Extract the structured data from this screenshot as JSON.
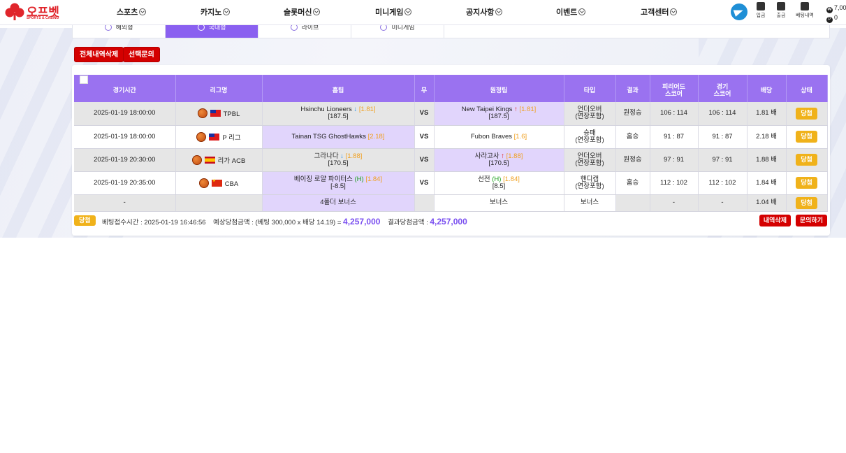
{
  "brand": {
    "name": "오프벳",
    "sub": "SPORTS & CASINO"
  },
  "nav": [
    "스포츠",
    "카지노",
    "슬롯머신",
    "미니게임",
    "공지사항",
    "이벤트",
    "고객센터"
  ],
  "header_icons": [
    {
      "icon": "deposit-icon",
      "label": "입금"
    },
    {
      "icon": "withdraw-icon",
      "label": "출금"
    },
    {
      "icon": "bet-history-icon",
      "label": "베팅내역"
    }
  ],
  "wallet": {
    "money": "7,00",
    "points": "0"
  },
  "tabs": [
    "해외형",
    "국내형",
    "라이브",
    "미니게임"
  ],
  "actions": {
    "delete_all": "전체내역삭제",
    "inquiry": "선택문의"
  },
  "table": {
    "headers": [
      "경기시간",
      "리그명",
      "홈팀",
      "무",
      "원정팀",
      "타입",
      "결과",
      "피리어드\n스코어",
      "경기\n스코어",
      "배당",
      "상태"
    ],
    "rows": [
      {
        "time": "2025-01-19 18:00:00",
        "flag": "tw",
        "league": "TPBL",
        "home": "Hsinchu Lioneers",
        "home_arrow": "down",
        "home_odd": "[1.81]",
        "home_line": "[187.5]",
        "draw": "VS",
        "away": "New Taipei Kings",
        "away_arrow": "up",
        "away_odd": "[1.81]",
        "away_line": "[187.5]",
        "type": "언더오버\n(연장포함)",
        "result": "원정승",
        "period": "106 : 114",
        "score": "106 : 114",
        "odds": "1.81 배",
        "status": "당첨",
        "selected": "away"
      },
      {
        "time": "2025-01-19 18:00:00",
        "flag": "tw",
        "league": "P 리그",
        "home": "Tainan TSG GhostHawks",
        "home_arrow": "",
        "home_odd": "[2.18]",
        "home_line": "",
        "draw": "VS",
        "away": "Fubon Braves",
        "away_arrow": "",
        "away_odd": "[1.6]",
        "away_line": "",
        "type": "승패\n(연장포함)",
        "result": "홈승",
        "period": "91 : 87",
        "score": "91 : 87",
        "odds": "2.18 배",
        "status": "당첨",
        "selected": "home"
      },
      {
        "time": "2025-01-19 20:30:00",
        "flag": "es",
        "league": "리가 ACB",
        "home": "그라나다",
        "home_arrow": "down",
        "home_odd": "[1.88]",
        "home_line": "[170.5]",
        "draw": "VS",
        "away": "사라고사",
        "away_arrow": "up",
        "away_odd": "[1.88]",
        "away_line": "[170.5]",
        "type": "언더오버\n(연장포함)",
        "result": "원정승",
        "period": "97 : 91",
        "score": "97 : 91",
        "odds": "1.88 배",
        "status": "당첨",
        "selected": "away"
      },
      {
        "time": "2025-01-19 20:35:00",
        "flag": "cn",
        "league": "CBA",
        "home": "베이징 로얄 파이터스",
        "home_h": "(H)",
        "home_arrow": "",
        "home_odd": "[1.84]",
        "home_line": "[-8.5]",
        "draw": "VS",
        "away": "선전",
        "away_h": "(H)",
        "away_arrow": "",
        "away_odd": "[1.84]",
        "away_line": "[8.5]",
        "type": "핸디캡\n(연장포함)",
        "result": "홈승",
        "period": "112 : 102",
        "score": "112 : 102",
        "odds": "1.84 배",
        "status": "당첨",
        "selected": "home"
      }
    ],
    "bonus_row": {
      "time": "-",
      "home": "4폴더 보너스",
      "away": "보너스",
      "type": "보너스",
      "period": "-",
      "score": "-",
      "odds": "1.04 배",
      "status": "당첨"
    }
  },
  "footer": {
    "status": "당첨",
    "bet_time_label": "베팅접수시간 : 2025-01-19 16:46:56",
    "expected_label": "예상당첨금액 : (베팅 300,000 x 배당 14.19) =",
    "expected_amount": "4,257,000",
    "result_label": "결과당첨금액 :",
    "result_amount": "4,257,000",
    "delete_btn": "내역삭제",
    "inquiry_btn": "문의하기"
  }
}
